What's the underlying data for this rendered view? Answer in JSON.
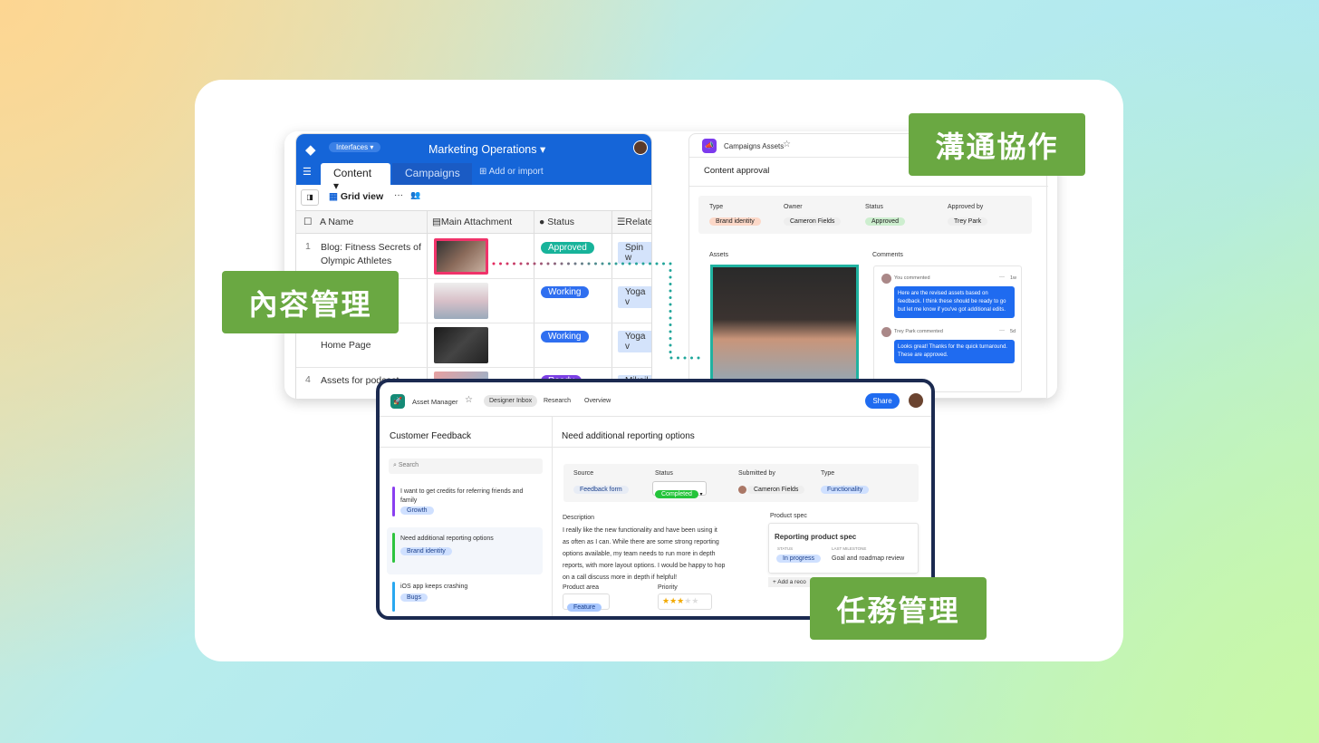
{
  "labels": {
    "collab": "溝通協作",
    "content": "內容管理",
    "tasks": "任務管理"
  },
  "colors": {
    "label_green": "#6aa842",
    "airtable_blue": "#1565d8",
    "share_blue": "#1f6bf0",
    "frame_navy": "#1b2a50"
  },
  "grid": {
    "interfaces": "Interfaces ▾",
    "title": "Marketing Operations ▾",
    "tabs": [
      {
        "label": "Content ▾",
        "active": true
      },
      {
        "label": "Campaigns"
      },
      {
        "label": "Add or import"
      }
    ],
    "view": "Grid view",
    "view_more": "···",
    "columns": [
      "Name",
      "Main Attachment",
      "Status",
      "Relate"
    ],
    "rows": [
      {
        "num": "1",
        "name": "Blog: Fitness Secrets of Olympic Athletes",
        "status": "Approved",
        "status_color": "#17b39a",
        "related": "Spin w"
      },
      {
        "num": "",
        "name": "",
        "status": "Working",
        "status_color": "#2f6ff0",
        "related": "Yoga v"
      },
      {
        "num": "",
        "name": "Home Page",
        "status": "Working",
        "status_color": "#2f6ff0",
        "related": "Yoga v"
      },
      {
        "num": "4",
        "name": "Assets for podcast",
        "status": "Ready",
        "status_color": "#7b3fe4",
        "related": "Mikail"
      }
    ]
  },
  "campaign": {
    "app": "Campaigns Assets",
    "title": "Content approval",
    "fields": [
      {
        "label": "Type",
        "value": "Brand identity"
      },
      {
        "label": "Owner",
        "value": "Cameron Fields"
      },
      {
        "label": "Status",
        "value": "Approved"
      },
      {
        "label": "Approved by",
        "value": "Trey Park"
      }
    ],
    "assets_label": "Assets",
    "comments_label": "Comments",
    "comments": [
      {
        "author": "You commented",
        "time": "1w",
        "more": "···",
        "text": "Here are the revised assets based on feedback. I think these should be ready to go but let me know if you've got additional edits."
      },
      {
        "author": "Trey Park commented",
        "time": "5d",
        "more": "···",
        "text": "Looks great! Thanks for the quick turnaround. These are approved."
      }
    ]
  },
  "asset": {
    "app": "Asset Manager",
    "nav": [
      "Designer Inbox",
      "Research",
      "Overview"
    ],
    "share": "Share",
    "list_title": "Customer Feedback",
    "search_placeholder": "Search",
    "items": [
      {
        "title": "I want to get credits for referring friends and family",
        "tag": "Growth",
        "color": "#8a3ff0"
      },
      {
        "title": "Need additional reporting options",
        "tag": "Brand identity",
        "color": "#2ec43f",
        "selected": true
      },
      {
        "title": "iOS app keeps crashing",
        "tag": "Bugs",
        "color": "#29a8f0"
      }
    ],
    "detail_title": "Need additional reporting options",
    "fields": [
      {
        "label": "Source",
        "value": "Feedback form"
      },
      {
        "label": "Status",
        "value": "Completed"
      },
      {
        "label": "Submitted by",
        "value": "Cameron Fields"
      },
      {
        "label": "Type",
        "value": "Functionality"
      }
    ],
    "description_label": "Description",
    "description": "I really like the new functionality and have been using it as often as I can. While there are some strong reporting options available, my team needs to run more in depth reports, with more layout options. I would be happy to hop on a call discuss more in depth if helpful!",
    "product_area_label": "Product area",
    "product_area": "Feature",
    "priority_label": "Priority",
    "priority": 3,
    "priority_max": 5,
    "spec_label": "Product spec",
    "spec_title": "Reporting product spec",
    "spec_status_label": "STATUS",
    "spec_status": "In progress",
    "spec_milestone_label": "LAST MILESTONE",
    "spec_milestone": "Goal and roadmap review",
    "add_record": "+ Add a reco"
  }
}
